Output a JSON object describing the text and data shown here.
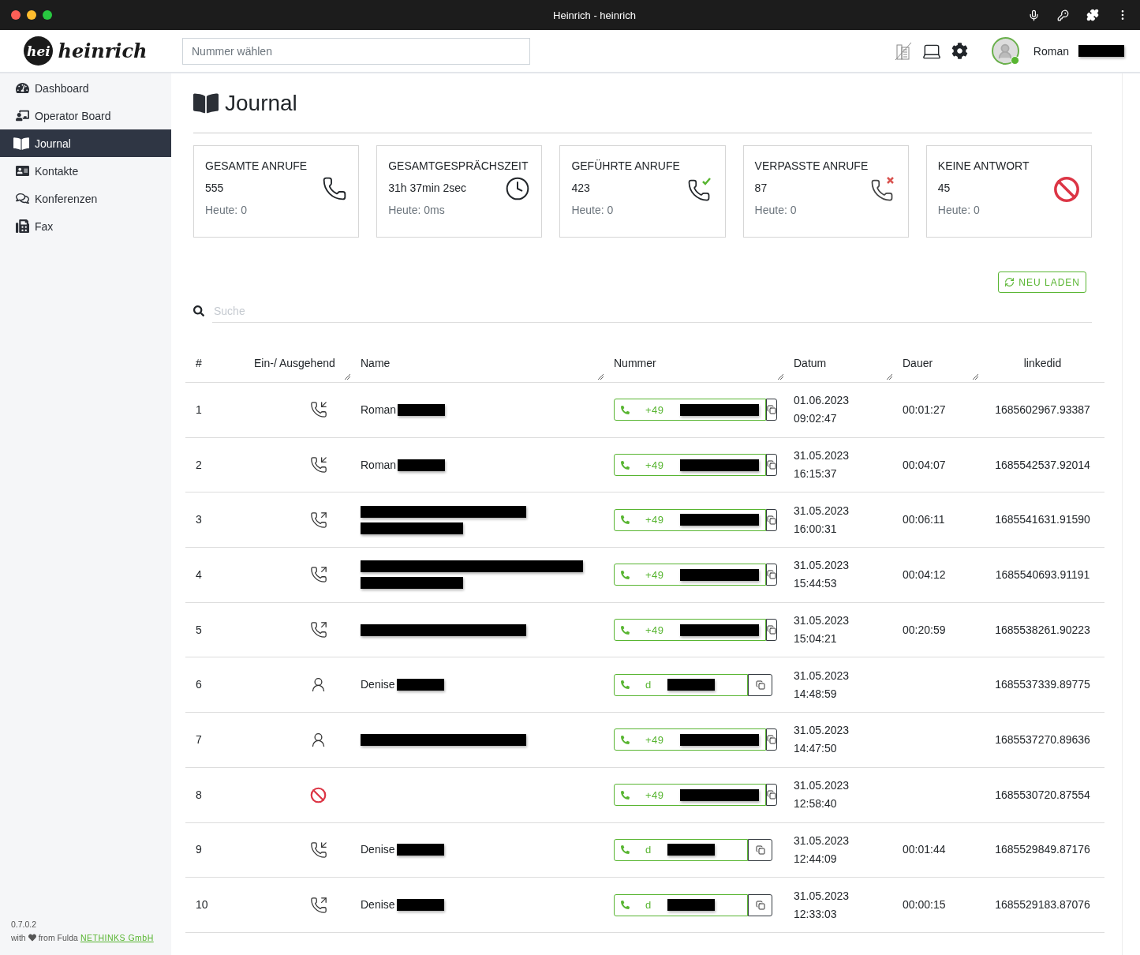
{
  "window": {
    "title": "Heinrich - heinrich"
  },
  "header": {
    "logo": {
      "badge": "hei",
      "name": "heinrich"
    },
    "dial": {
      "placeholder": "Nummer wählen"
    },
    "user": {
      "name": "Roman",
      "online": true
    }
  },
  "sidebar": {
    "items": [
      {
        "label": "Dashboard",
        "kind": "dashboard",
        "selected": false
      },
      {
        "label": "Operator Board",
        "kind": "board",
        "selected": false
      },
      {
        "label": "Journal",
        "kind": "journal",
        "selected": true
      },
      {
        "label": "Kontakte",
        "kind": "contacts",
        "selected": false
      },
      {
        "label": "Konferenzen",
        "kind": "conference",
        "selected": false
      },
      {
        "label": "Fax",
        "kind": "fax",
        "selected": false
      }
    ],
    "version": "0.7.0.2",
    "footer": {
      "prefix": "with",
      "middle": "from Fulda",
      "link": "NETHINKS GmbH"
    }
  },
  "page": {
    "title": "Journal"
  },
  "stats": [
    {
      "kind": "total",
      "label": "GESAMTE ANRUFE",
      "value": "555",
      "today": "Heute: 0"
    },
    {
      "kind": "duration",
      "label": "GESAMTGESPRÄCHSZEIT",
      "value": "31h 37min 2sec",
      "today": "Heute: 0ms"
    },
    {
      "kind": "completed",
      "label": "GEFÜHRTE ANRUFE",
      "value": "423",
      "today": "Heute: 0"
    },
    {
      "kind": "missed",
      "label": "VERPASSTE ANRUFE",
      "value": "87",
      "today": "Heute: 0"
    },
    {
      "kind": "noanswer",
      "label": "KEINE ANTWORT",
      "value": "45",
      "today": "Heute: 0"
    }
  ],
  "reload_button": "NEU LADEN",
  "search": {
    "placeholder": "Suche"
  },
  "table": {
    "columns": [
      "#",
      "Ein-/ Ausgehend",
      "Name",
      "Nummer",
      "Datum",
      "Dauer",
      "linkedid"
    ],
    "rows": [
      {
        "index": "1",
        "kind": "incoming",
        "name": "Roman",
        "name_redactions": [
          {
            "kind": "short"
          }
        ],
        "number": "+49",
        "date": "01.06.2023",
        "time": "09:02:47",
        "duration": "00:01:27",
        "linkedid": "1685602967.93387"
      },
      {
        "index": "2",
        "kind": "incoming",
        "name": "Roman",
        "name_redactions": [
          {
            "kind": "short"
          }
        ],
        "number": "+49",
        "date": "31.05.2023",
        "time": "16:15:37",
        "duration": "00:04:07",
        "linkedid": "1685542537.92014"
      },
      {
        "index": "3",
        "kind": "outgoing",
        "name_redactions": [
          {
            "kind": "long"
          },
          {
            "kind": "medium"
          }
        ],
        "number": "+49",
        "date": "31.05.2023",
        "time": "16:00:31",
        "duration": "00:06:11",
        "linkedid": "1685541631.91590"
      },
      {
        "index": "4",
        "kind": "outgoing",
        "name_redactions": [
          {
            "kind": "xlong"
          },
          {
            "kind": "medium"
          }
        ],
        "number": "+49",
        "date": "31.05.2023",
        "time": "15:44:53",
        "duration": "00:04:12",
        "linkedid": "1685540693.91191"
      },
      {
        "index": "5",
        "kind": "outgoing",
        "name_redactions": [
          {
            "kind": "long"
          }
        ],
        "number": "+49",
        "date": "31.05.2023",
        "time": "15:04:21",
        "duration": "00:20:59",
        "linkedid": "1685538261.90223"
      },
      {
        "index": "6",
        "kind": "internal",
        "name": "Denise",
        "name_redactions": [
          {
            "kind": "short"
          }
        ],
        "number": "d",
        "date": "31.05.2023",
        "time": "14:48:59",
        "linkedid": "1685537339.89775"
      },
      {
        "index": "7",
        "kind": "internal",
        "name_redactions": [
          {
            "kind": "long"
          }
        ],
        "number": "+49",
        "date": "31.05.2023",
        "time": "14:47:50",
        "linkedid": "1685537270.89636"
      },
      {
        "index": "8",
        "kind": "blocked",
        "number": "+49",
        "date": "31.05.2023",
        "time": "12:58:40",
        "linkedid": "1685530720.87554"
      },
      {
        "index": "9",
        "kind": "incoming",
        "name": "Denise",
        "name_redactions": [
          {
            "kind": "short"
          }
        ],
        "number": "d",
        "date": "31.05.2023",
        "time": "12:44:09",
        "duration": "00:01:44",
        "linkedid": "1685529849.87176"
      },
      {
        "index": "10",
        "kind": "outgoing",
        "name": "Denise",
        "name_redactions": [
          {
            "kind": "short"
          }
        ],
        "number": "d",
        "date": "31.05.2023",
        "time": "12:33:03",
        "duration": "00:00:15",
        "linkedid": "1685529183.87076"
      }
    ]
  }
}
